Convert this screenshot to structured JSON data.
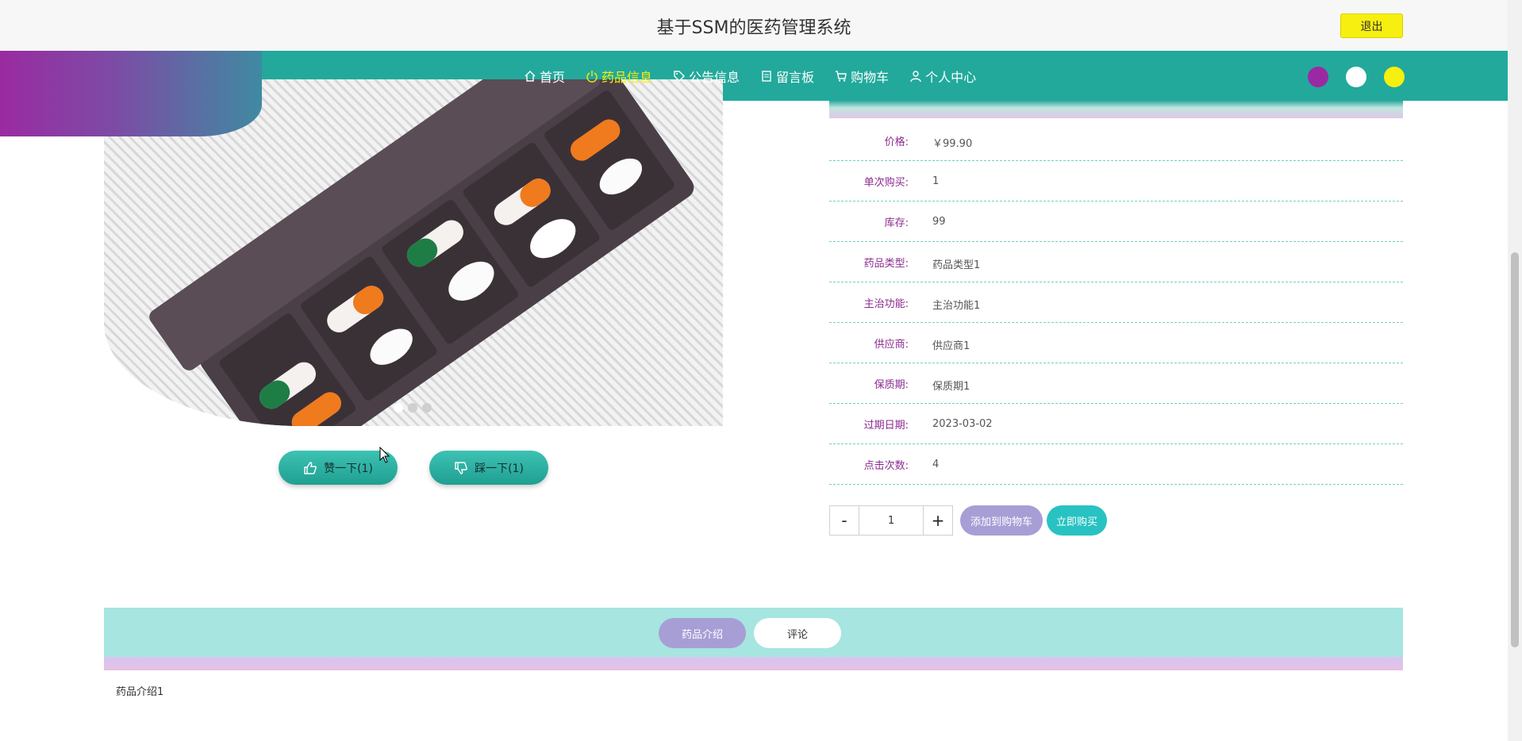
{
  "header": {
    "title": "基于SSM的医药管理系统",
    "logout_label": "退出"
  },
  "nav": {
    "items": [
      {
        "label": "首页",
        "icon": "home-icon"
      },
      {
        "label": "药品信息",
        "icon": "power-icon",
        "active": true
      },
      {
        "label": "公告信息",
        "icon": "tag-icon"
      },
      {
        "label": "留言板",
        "icon": "clipboard-icon"
      },
      {
        "label": "购物车",
        "icon": "cart-icon"
      },
      {
        "label": "个人中心",
        "icon": "user-icon"
      }
    ],
    "theme_colors": [
      "#9b2aa2",
      "#ffffff",
      "#f7ef0f"
    ]
  },
  "gallery": {
    "slides_count": 3,
    "active_slide": 1
  },
  "votes": {
    "like_label": "赞一下(1)",
    "dislike_label": "踩一下(1)"
  },
  "details": [
    {
      "label": "价格:",
      "value": "￥99.90"
    },
    {
      "label": "单次购买:",
      "value": "1"
    },
    {
      "label": "库存:",
      "value": "99"
    },
    {
      "label": "药品类型:",
      "value": "药品类型1"
    },
    {
      "label": "主治功能:",
      "value": "主治功能1"
    },
    {
      "label": "供应商:",
      "value": "供应商1"
    },
    {
      "label": "保质期:",
      "value": "保质期1"
    },
    {
      "label": "过期日期:",
      "value": "2023-03-02"
    },
    {
      "label": "点击次数:",
      "value": "4"
    }
  ],
  "purchase": {
    "minus_label": "-",
    "plus_label": "+",
    "quantity": "1",
    "add_to_cart_label": "添加到购物车",
    "buy_now_label": "立即购买"
  },
  "tabs": {
    "intro_label": "药品介绍",
    "comments_label": "评论",
    "intro_text": "药品介绍1"
  }
}
